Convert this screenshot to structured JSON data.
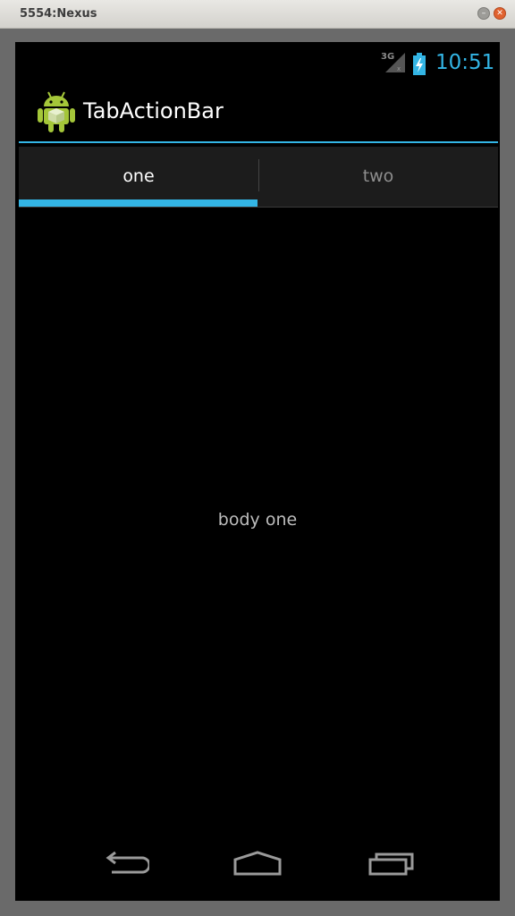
{
  "window": {
    "title": "5554:Nexus"
  },
  "status_bar": {
    "network": "3G",
    "time": "10:51",
    "accent": "#33b5e5"
  },
  "action_bar": {
    "title": "TabActionBar",
    "icon": "android-robot-icon"
  },
  "tabs": [
    {
      "label": "one",
      "selected": true
    },
    {
      "label": "two",
      "selected": false
    }
  ],
  "content": {
    "body_text": "body one"
  },
  "nav_bar": {
    "buttons": [
      "back-icon",
      "home-icon",
      "recent-apps-icon"
    ]
  }
}
